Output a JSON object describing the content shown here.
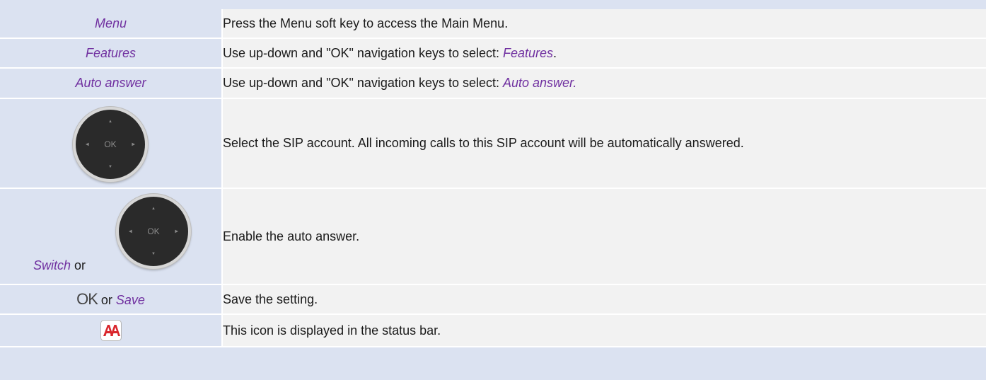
{
  "header": {
    "glyph": "'"
  },
  "rows": [
    {
      "key": "Menu",
      "desc": "Press the Menu soft key to access the Main Menu."
    },
    {
      "key": "Features",
      "desc_prefix": "Use up-down and \"OK\" navigation keys to select: ",
      "desc_em": "Features",
      "desc_suffix": "."
    },
    {
      "key": "Auto answer",
      "desc_prefix": "Use up-down and \"OK\" navigation keys to select: ",
      "desc_em": "Auto answer."
    },
    {
      "key_icon": "navigation-pad-icon",
      "key_ok": "OK",
      "desc": "Select the SIP account. All incoming calls to this SIP account will be automatically answered."
    },
    {
      "key_em": "Switch",
      "key_or": " or",
      "key_icon": "navigation-pad-icon",
      "key_ok": "OK",
      "desc": "Enable the auto answer."
    },
    {
      "key_ok_glyph": "OK",
      "key_or": " or ",
      "key_em": "Save",
      "desc": "Save the setting."
    },
    {
      "key_icon": "auto-answer-status-icon",
      "desc": "This icon is displayed in the status bar."
    }
  ],
  "colors": {
    "key_bg": "#dbe2f1",
    "desc_bg": "#f2f2f2",
    "accent": "#7030a0",
    "icon_red": "#d9262c"
  }
}
